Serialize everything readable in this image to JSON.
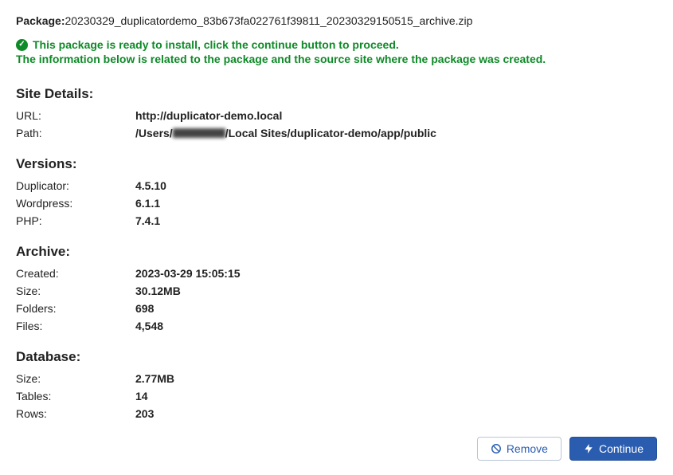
{
  "package": {
    "label": "Package:",
    "filename": "20230329_duplicatordemo_83b673fa022761f39811_20230329150515_archive.zip"
  },
  "status": {
    "ready_text": "This package is ready to install, click the continue button to proceed.",
    "info_text": "The information below is related to the package and the source site where the package was created."
  },
  "site_details": {
    "heading": "Site Details:",
    "url_label": "URL:",
    "url_value": "http://duplicator-demo.local",
    "path_label": "Path:",
    "path_prefix": "/Users/",
    "path_suffix": "/Local Sites/duplicator-demo/app/public"
  },
  "versions": {
    "heading": "Versions:",
    "duplicator_label": "Duplicator:",
    "duplicator_value": "4.5.10",
    "wordpress_label": "Wordpress:",
    "wordpress_value": "6.1.1",
    "php_label": "PHP:",
    "php_value": "7.4.1"
  },
  "archive": {
    "heading": "Archive:",
    "created_label": "Created:",
    "created_value": "2023-03-29 15:05:15",
    "size_label": "Size:",
    "size_value": "30.12MB",
    "folders_label": "Folders:",
    "folders_value": "698",
    "files_label": "Files:",
    "files_value": "4,548"
  },
  "database": {
    "heading": "Database:",
    "size_label": "Size:",
    "size_value": "2.77MB",
    "tables_label": "Tables:",
    "tables_value": "14",
    "rows_label": "Rows:",
    "rows_value": "203"
  },
  "buttons": {
    "remove": "Remove",
    "continue": "Continue"
  }
}
